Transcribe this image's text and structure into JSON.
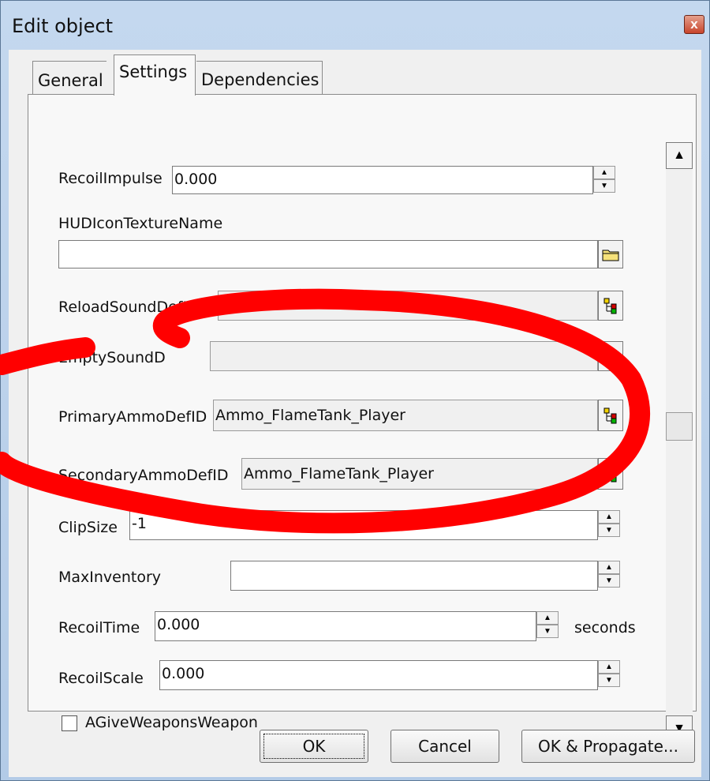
{
  "window": {
    "title": "Edit object",
    "close_glyph": "x"
  },
  "tabs": [
    {
      "label": "General"
    },
    {
      "label": "Settings"
    },
    {
      "label": "Dependencies"
    }
  ],
  "fields": {
    "recoil_impulse": {
      "label": "RecoilImpulse",
      "value": "0.000"
    },
    "hud_icon": {
      "label": "HUDIconTextureName",
      "value": ""
    },
    "reload_sound": {
      "label": "ReloadSoundDefID",
      "value": ""
    },
    "empty_sound": {
      "label": "EmptySoundD",
      "value": ""
    },
    "primary_ammo": {
      "label": "PrimaryAmmoDefID",
      "value": "Ammo_FlameTank_Player"
    },
    "secondary_ammo": {
      "label": "SecondaryAmmoDefID",
      "value": "Ammo_FlameTank_Player"
    },
    "clip_size": {
      "label": "ClipSize",
      "value": "-1"
    },
    "max_inventory": {
      "label": "MaxInventory",
      "value": ""
    },
    "recoil_time": {
      "label": "RecoilTime",
      "value": "0.000",
      "unit": "seconds"
    },
    "recoil_scale": {
      "label": "RecoilScale",
      "value": "0.000"
    },
    "give_weapons": {
      "label": "AGiveWeaponsWeapon",
      "checked": false
    }
  },
  "buttons": {
    "ok": "OK",
    "cancel": "Cancel",
    "ok_propagate": "OK & Propagate..."
  },
  "icons": {
    "browse": "folder-icon",
    "picker": "tree-picker-icon",
    "scroll_up": "up-arrow-icon",
    "scroll_down": "down-arrow-icon"
  },
  "colors": {
    "annotation": "#ff0000",
    "close_button": "#c8452c",
    "title_bar": "#c4d8ef"
  }
}
